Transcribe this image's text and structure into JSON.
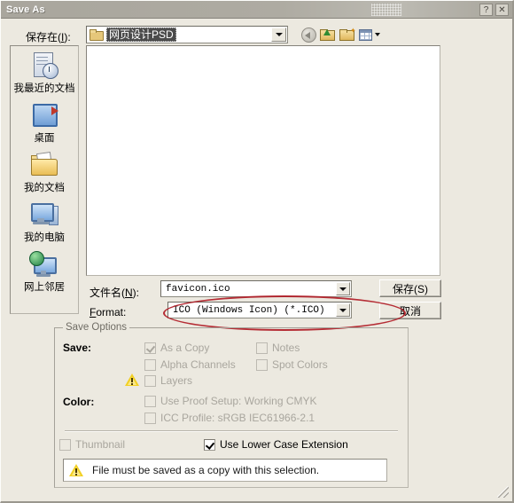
{
  "window": {
    "title": "Save As",
    "help_button": "?",
    "close_button": "✕"
  },
  "toolbar": {
    "save_in_label": "保存在(I):",
    "save_in_value": "网页设计PSD",
    "back_icon": "back-arrow-icon",
    "up_icon": "up-one-level-icon",
    "new_folder_icon": "create-new-folder-icon",
    "views_icon": "views-menu-icon"
  },
  "places": {
    "items": [
      {
        "label": "我最近的文档",
        "icon": "recent-documents-icon"
      },
      {
        "label": "桌面",
        "icon": "desktop-icon"
      },
      {
        "label": "我的文档",
        "icon": "my-documents-icon"
      },
      {
        "label": "我的电脑",
        "icon": "my-computer-icon"
      },
      {
        "label": "网上邻居",
        "icon": "network-places-icon"
      }
    ]
  },
  "filename": {
    "label": "文件名(N):",
    "value": "favicon.ico"
  },
  "format": {
    "label": "Format:",
    "value": "ICO (Windows Icon) (*.ICO)"
  },
  "buttons": {
    "save": "保存(S)",
    "cancel": "取消"
  },
  "save_options": {
    "legend": "Save Options",
    "save_label": "Save:",
    "color_label": "Color:",
    "checkboxes": [
      {
        "label": "As a Copy",
        "checked": true,
        "enabled": false
      },
      {
        "label": "Alpha Channels",
        "checked": false,
        "enabled": false
      },
      {
        "label": "Layers",
        "checked": false,
        "enabled": false
      },
      {
        "label": "Notes",
        "checked": false,
        "enabled": false
      },
      {
        "label": "Spot Colors",
        "checked": false,
        "enabled": false
      },
      {
        "label": "Use Proof Setup:  Working CMYK",
        "checked": false,
        "enabled": false
      },
      {
        "label": "ICC Profile:  sRGB IEC61966-2.1",
        "checked": false,
        "enabled": false
      },
      {
        "label": "Thumbnail",
        "checked": false,
        "enabled": false
      },
      {
        "label": "Use Lower Case Extension",
        "checked": true,
        "enabled": true
      }
    ]
  },
  "warning": {
    "message": "File must be saved as a copy with this selection.",
    "icon": "warning-triangle-icon"
  },
  "annotation": {
    "shape": "red-ellipse",
    "color": "#b01c26"
  }
}
